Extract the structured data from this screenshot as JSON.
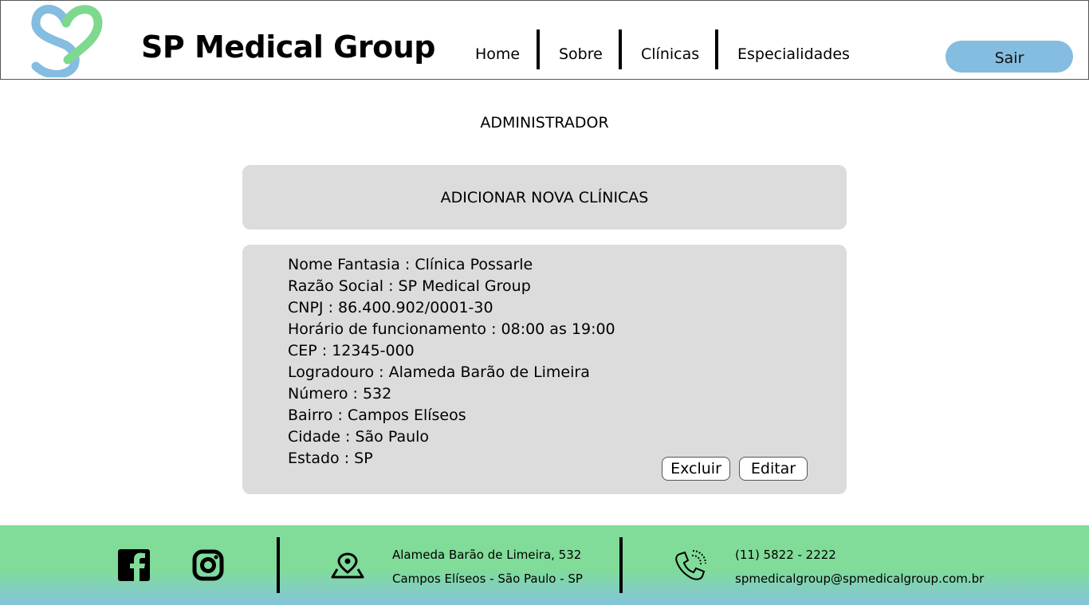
{
  "header": {
    "brand": "SP Medical Group",
    "nav": [
      "Home",
      "Sobre",
      "Clínicas",
      "Especialidades"
    ],
    "logout_label": "Sair",
    "logo_icon": "sp-heart-logo",
    "colors": {
      "logo_green": "#7ed98f",
      "logo_blue": "#84bde0",
      "logout_bg": "#84bde0"
    }
  },
  "main": {
    "role": "ADMINISTRADOR",
    "add_label": "ADICIONAR NOVA CLÍNICAS",
    "clinic": {
      "fields": [
        "Nome Fantasia : Clínica Possarle",
        "Razão Social : SP Medical Group",
        "CNPJ : 86.400.902/0001-30",
        "Horário de funcionamento : 08:00 as 19:00",
        "CEP : 12345-000",
        "Logradouro : Alameda Barão de Limeira",
        "Número : 532",
        "Bairro : Campos Elíseos",
        "Cidade : São Paulo",
        "Estado : SP"
      ],
      "delete_label": "Excluir",
      "edit_label": "Editar"
    },
    "colors": {
      "panel_bg": "#dcdcdc"
    }
  },
  "footer": {
    "address_line1": "Alameda Barão de Limeira, 532",
    "address_line2": "Campos Elíseos - São Paulo - SP",
    "phone": "(11) 5822 - 2222",
    "email": "spmedicalgroup@spmedicalgroup.com.br",
    "icons": [
      "facebook-icon",
      "instagram-icon",
      "map-pin-icon",
      "phone-icon"
    ],
    "colors": {
      "gradient_top": "#80dc98",
      "gradient_bottom": "#84c4dc"
    }
  }
}
